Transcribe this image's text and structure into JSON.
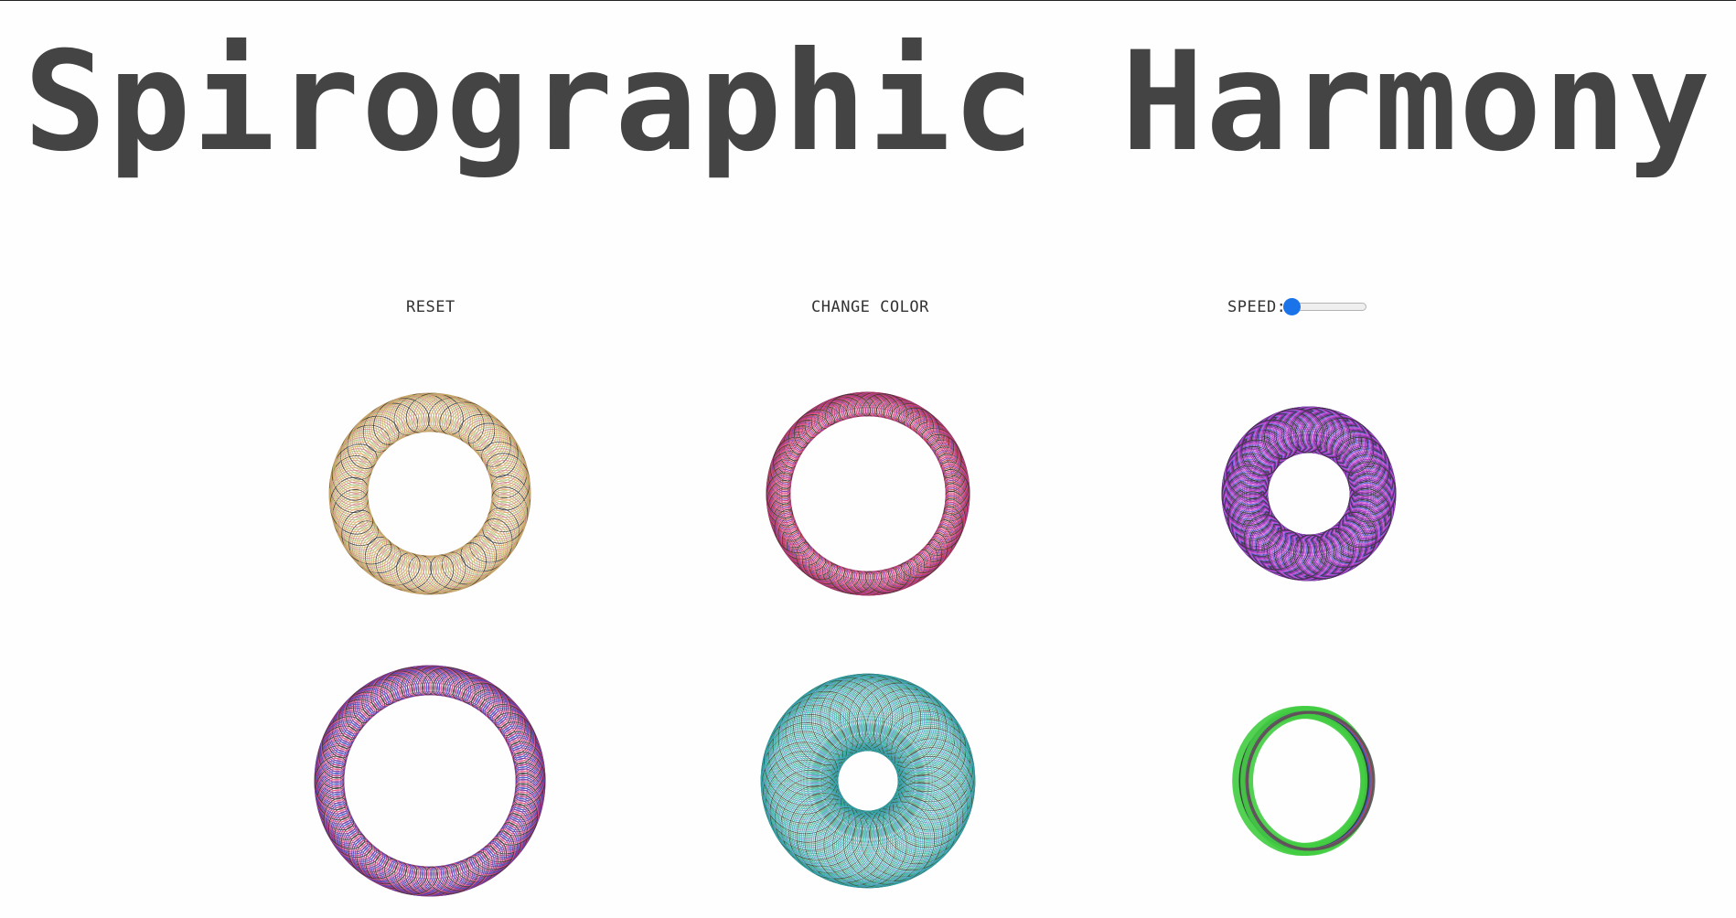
{
  "page": {
    "title": "Spirographic Harmony"
  },
  "controls": {
    "reset_label": "RESET",
    "change_color_label": "CHANGE COLOR",
    "speed_label": "SPEED:",
    "speed_value_fraction": 0.0,
    "accent_color": "#1a73e8"
  },
  "spirographs": [
    {
      "name": "spiro-1",
      "palette": [
        "#e0a060",
        "#a8c070",
        "#d08080",
        "#c8b060",
        "#333333"
      ]
    },
    {
      "name": "spiro-2",
      "palette": [
        "#d03070",
        "#8040b0",
        "#c04040",
        "#333333",
        "#e05080"
      ]
    },
    {
      "name": "spiro-3",
      "palette": [
        "#b030c0",
        "#7030a0",
        "#333333",
        "#6060e0",
        "#d060d0"
      ]
    },
    {
      "name": "spiro-4",
      "palette": [
        "#b03080",
        "#4050c0",
        "#7030a0",
        "#e05080",
        "#333333"
      ]
    },
    {
      "name": "spiro-5",
      "palette": [
        "#20b0a0",
        "#40a070",
        "#333333",
        "#30c0c0",
        "#6080c0"
      ]
    },
    {
      "name": "spiro-6",
      "palette": [
        "#40cc40",
        "#333333",
        "#4060d0",
        "#c04060",
        "#555555"
      ]
    }
  ]
}
